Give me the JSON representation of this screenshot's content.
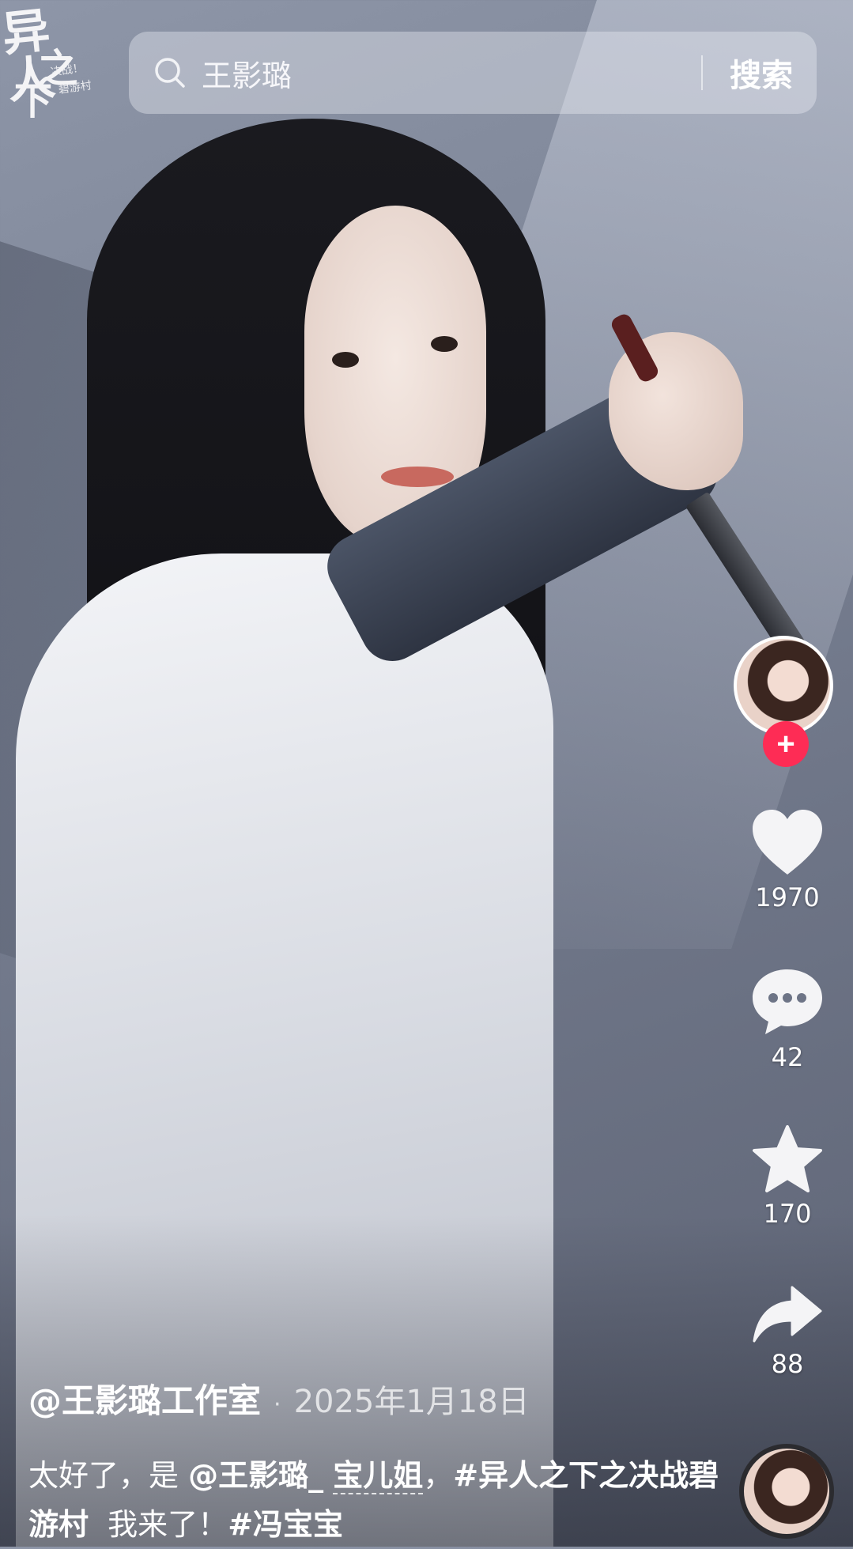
{
  "watermark": {
    "logo_title": "异人之下",
    "subtitle": "决战！碧游村"
  },
  "search": {
    "query": "王影璐",
    "button_label": "搜索"
  },
  "actions": {
    "like_count": "1970",
    "comment_count": "42",
    "favorite_count": "170",
    "share_count": "88",
    "follow_label": "+"
  },
  "post": {
    "author": "@王影璐工作室",
    "separator": "·",
    "date": "2025年1月18日",
    "caption": {
      "part1": "太好了，是 ",
      "mention_a": "@王影璐_",
      "space": " ",
      "mention_b": "宝儿姐",
      "part2": "，",
      "tag1": "#异人之下之决战碧游村",
      "part3": "  我来了！",
      "tag2": "#冯宝宝"
    }
  },
  "icons": {
    "search": "search-icon",
    "like": "heart-icon",
    "comment": "comment-icon",
    "favorite": "star-icon",
    "share": "share-icon"
  },
  "colors": {
    "follow": "#fe2c55",
    "text": "#ffffff"
  }
}
